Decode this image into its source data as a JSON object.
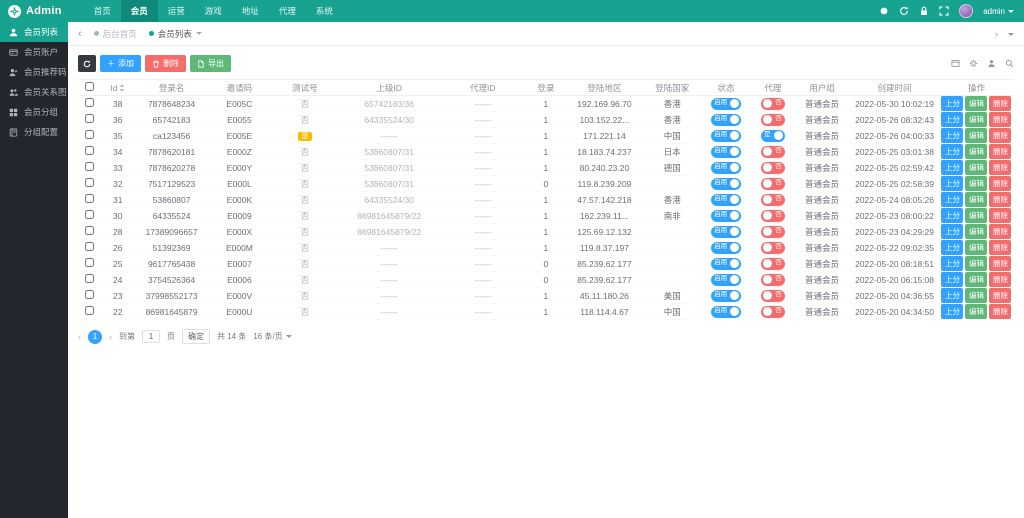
{
  "colors": {
    "brand": "#18a391",
    "blue": "#33a2ff",
    "red": "#f56c6c",
    "green": "#5fb878",
    "warn": "#ffb800",
    "sidebar": "#23262d"
  },
  "header": {
    "logo_text": "Admin",
    "nav": [
      {
        "label": "首页",
        "active": false
      },
      {
        "label": "会员",
        "active": true
      },
      {
        "label": "运营",
        "active": false
      },
      {
        "label": "游戏",
        "active": false
      },
      {
        "label": "地址",
        "active": false
      },
      {
        "label": "代理",
        "active": false
      },
      {
        "label": "系统",
        "active": false
      }
    ],
    "right_icons": [
      "theme-icon",
      "refresh-icon",
      "lock-icon",
      "fullscreen-icon"
    ],
    "user": {
      "name": "admin"
    }
  },
  "sidebar": {
    "items": [
      {
        "label": "会员列表",
        "icon": "user-icon",
        "active": true
      },
      {
        "label": "会员账户",
        "icon": "card-icon",
        "active": false
      },
      {
        "label": "会员推荐码",
        "icon": "user-plus-icon",
        "active": false
      },
      {
        "label": "会员关系图",
        "icon": "users-icon",
        "active": false
      },
      {
        "label": "会员分组",
        "icon": "grid-icon",
        "active": false
      },
      {
        "label": "分组配置",
        "icon": "book-icon",
        "active": false
      }
    ]
  },
  "breadcrumb": {
    "back": "‹",
    "items": [
      {
        "label": "后台首页",
        "active": false
      },
      {
        "label": "会员列表",
        "active": true
      }
    ]
  },
  "toolbar": {
    "add_label": "添加",
    "delete_label": "删除",
    "export_label": "导出",
    "right_icons": [
      "card-view-icon",
      "gear-icon",
      "user-filter-icon",
      "search-icon"
    ]
  },
  "table": {
    "columns": [
      "Id",
      "登录名",
      "邀请码",
      "测试号",
      "上级ID",
      "代理ID",
      "登录",
      "登陆地区",
      "登陆国家",
      "状态",
      "代理",
      "用户组",
      "创建时间",
      "操作"
    ],
    "status_on_label": "启用",
    "yes_label": "是",
    "no_label": "否",
    "action_labels": {
      "score": "上分",
      "edit": "编辑",
      "delete": "删除"
    },
    "rows": [
      {
        "id": "38",
        "username": "7878648234",
        "invite_code": "E005C",
        "test": "否",
        "parent_id": "65742183/36",
        "agent_id": "------",
        "login": "1",
        "region": "192.169.96.70",
        "country": "香港",
        "status": "启用",
        "agent": "否",
        "group": "普通会员",
        "created": "2022-05-30 10:02:19"
      },
      {
        "id": "36",
        "username": "65742183",
        "invite_code": "E0055",
        "test": "否",
        "parent_id": "64335524/30",
        "agent_id": "------",
        "login": "1",
        "region": "103.152.22...",
        "country": "香港",
        "status": "启用",
        "agent": "否",
        "group": "普通会员",
        "created": "2022-05-26 08:32:43"
      },
      {
        "id": "35",
        "username": "ca123456",
        "invite_code": "E005E",
        "test": "是",
        "parent_id": "------",
        "agent_id": "------",
        "login": "1",
        "region": "171.221.14",
        "country": "中国",
        "status": "启用",
        "agent": "是",
        "group": "普通会员",
        "created": "2022-05-26 04:00:33"
      },
      {
        "id": "34",
        "username": "7878620181",
        "invite_code": "E000Z",
        "test": "否",
        "parent_id": "53860807/31",
        "agent_id": "------",
        "login": "1",
        "region": "18.183.74.237",
        "country": "日本",
        "status": "启用",
        "agent": "否",
        "group": "普通会员",
        "created": "2022-05-25 03:01:38"
      },
      {
        "id": "33",
        "username": "7878620278",
        "invite_code": "E000Y",
        "test": "否",
        "parent_id": "53860807/31",
        "agent_id": "------",
        "login": "1",
        "region": "80.240.23.20",
        "country": "德国",
        "status": "启用",
        "agent": "否",
        "group": "普通会员",
        "created": "2022-05-25 02:59:42"
      },
      {
        "id": "32",
        "username": "7517129523",
        "invite_code": "E000L",
        "test": "否",
        "parent_id": "53860807/31",
        "agent_id": "------",
        "login": "0",
        "region": "119.8.239.209",
        "country": "",
        "status": "启用",
        "agent": "否",
        "group": "普通会员",
        "created": "2022-05-25 02:58:39"
      },
      {
        "id": "31",
        "username": "53860807",
        "invite_code": "E000K",
        "test": "否",
        "parent_id": "64335524/30",
        "agent_id": "------",
        "login": "1",
        "region": "47.57.142.218",
        "country": "香港",
        "status": "启用",
        "agent": "否",
        "group": "普通会员",
        "created": "2022-05-24 08:05:26"
      },
      {
        "id": "30",
        "username": "64335524",
        "invite_code": "E0009",
        "test": "否",
        "parent_id": "86981645879/22",
        "agent_id": "------",
        "login": "1",
        "region": "162.239.11...",
        "country": "南非",
        "status": "启用",
        "agent": "否",
        "group": "普通会员",
        "created": "2022-05-23 08:00:22"
      },
      {
        "id": "28",
        "username": "17389096657",
        "invite_code": "E000X",
        "test": "否",
        "parent_id": "86981645879/22",
        "agent_id": "------",
        "login": "1",
        "region": "125.69.12.132",
        "country": "",
        "status": "启用",
        "agent": "否",
        "group": "普通会员",
        "created": "2022-05-23 04:29:29"
      },
      {
        "id": "26",
        "username": "51392369",
        "invite_code": "E000M",
        "test": "否",
        "parent_id": "------",
        "agent_id": "------",
        "login": "1",
        "region": "119.8.37.197",
        "country": "",
        "status": "启用",
        "agent": "否",
        "group": "普通会员",
        "created": "2022-05-22 09:02:35"
      },
      {
        "id": "25",
        "username": "9617765438",
        "invite_code": "E0007",
        "test": "否",
        "parent_id": "------",
        "agent_id": "------",
        "login": "0",
        "region": "85.239.62.177",
        "country": "",
        "status": "启用",
        "agent": "否",
        "group": "普通会员",
        "created": "2022-05-20 08:18:51"
      },
      {
        "id": "24",
        "username": "3754526364",
        "invite_code": "E0006",
        "test": "否",
        "parent_id": "------",
        "agent_id": "------",
        "login": "0",
        "region": "85.239.62.177",
        "country": "",
        "status": "启用",
        "agent": "否",
        "group": "普通会员",
        "created": "2022-05-20 06:15:08"
      },
      {
        "id": "23",
        "username": "37998552173",
        "invite_code": "E000V",
        "test": "否",
        "parent_id": "------",
        "agent_id": "------",
        "login": "1",
        "region": "45.11.180.26",
        "country": "美国",
        "status": "启用",
        "agent": "否",
        "group": "普通会员",
        "created": "2022-05-20 04:36:55"
      },
      {
        "id": "22",
        "username": "86981645879",
        "invite_code": "E000U",
        "test": "否",
        "parent_id": "------",
        "agent_id": "------",
        "login": "1",
        "region": "118.114.4.67",
        "country": "中国",
        "status": "启用",
        "agent": "否",
        "group": "普通会员",
        "created": "2022-05-20 04:34:50"
      }
    ]
  },
  "pagination": {
    "prev": "‹",
    "next": "›",
    "current_page": "1",
    "goto_label": "到第",
    "goto_value": "1",
    "page_unit_label": "页",
    "confirm_label": "确定",
    "total_label": "共 14 条",
    "size_label": "16 条/页"
  }
}
